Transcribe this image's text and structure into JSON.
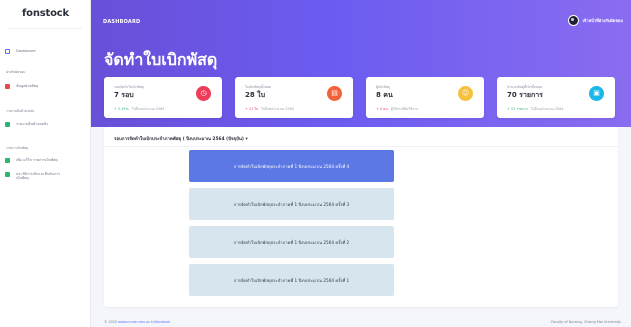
{
  "app": {
    "brand": "fonstock"
  },
  "topbar": {
    "title": "DASHBOARD",
    "user_name": "เจ้าหน้าที่ฝ่ายรับผิดชอบ"
  },
  "sidebar": {
    "dashboard": "Dashboard",
    "groups": [
      {
        "heading": "ฝ่ายรับผิดชอบ",
        "items": [
          {
            "label": "ข้อมูลฝ่ายพัสดุ"
          }
        ]
      },
      {
        "heading": "รายงานสินค้าคงคลัง",
        "items": [
          {
            "label": "รายงานสินค้าคงคลัง"
          }
        ]
      },
      {
        "heading": "รายการเบิกพัสดุ",
        "items": [
          {
            "label": "เพิ่ม แก้ไข รายการเบิกพัสดุ"
          },
          {
            "label": "ประวัติการเบิกและยืนยันการเบิกพัสดุ"
          }
        ]
      }
    ]
  },
  "page": {
    "heading": "จัดทำใบเบิกพัสดุ"
  },
  "cards": [
    {
      "title": "รอบจัดทำใบเบิกพัสดุ",
      "value": "7 รอบ",
      "delta": "+ 2.19%",
      "note": "ในปีงบประมาณ 2564",
      "icon": "clock-icon",
      "icon_glyph": "◷",
      "color": "#ec3d5a",
      "delta_color": "#2bb673"
    },
    {
      "title": "ใบเบิกพัสดุทั้งหมด",
      "value": "28 ใบ",
      "delta": "+ 11 ใบ",
      "note": "ในปีงบประมาณ 2564",
      "icon": "document-icon",
      "icon_glyph": "▤",
      "color": "#f2623a",
      "delta_color": "#ec3d5a"
    },
    {
      "title": "ผู้เบิกพัสดุ",
      "value": "8 คน",
      "delta": "+ 4 คน",
      "note": "ผู้ใช้งานที่ยังใช้งาน",
      "icon": "users-icon",
      "icon_glyph": "☺",
      "color": "#f6c23e",
      "delta_color": "#ec3d5a"
    },
    {
      "title": "จำนวนพัสดุที่เบิกทั้งหมด",
      "value": "70 รายการ",
      "delta": "+ 12 รายการ",
      "note": "ในปีงบประมาณ 2564",
      "icon": "box-icon",
      "icon_glyph": "▣",
      "color": "#1eb6e8",
      "delta_color": "#2bb673"
    }
  ],
  "panel": {
    "header": "รอบการจัดทำใบเบิกประจำภาคพัสดุ ( ปีงบประมาณ 2564 (ปัจจุบัน) ▾",
    "requests": [
      {
        "label": "การจัดทำใบเบิกพัสดุประจำภาคที่ 1 ปีงบประมาณ 2564 ครั้งที่ 4",
        "active": true
      },
      {
        "label": "การจัดทำใบเบิกพัสดุประจำภาคที่ 1 ปีงบประมาณ 2564 ครั้งที่ 3",
        "active": false
      },
      {
        "label": "การจัดทำใบเบิกพัสดุประจำภาคที่ 1 ปีงบประมาณ 2564 ครั้งที่ 2",
        "active": false
      },
      {
        "label": "การจัดทำใบเบิกพัสดุประจำภาคที่ 1 ปีงบประมาณ 2564 ครั้งที่ 1",
        "active": false
      }
    ]
  },
  "footer": {
    "copyright": "© 2020",
    "link": "www.nurse.cmu.ac.th/fonstock",
    "right": "Faculty of Nursing, Chiang Mai University"
  }
}
